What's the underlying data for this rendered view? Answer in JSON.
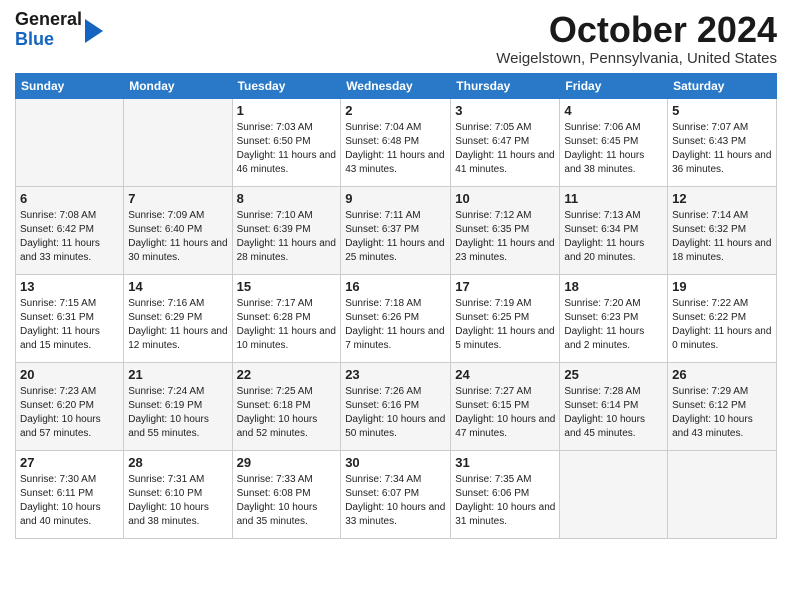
{
  "header": {
    "logo_general": "General",
    "logo_blue": "Blue",
    "month_title": "October 2024",
    "location": "Weigelstown, Pennsylvania, United States"
  },
  "days_of_week": [
    "Sunday",
    "Monday",
    "Tuesday",
    "Wednesday",
    "Thursday",
    "Friday",
    "Saturday"
  ],
  "weeks": [
    [
      {
        "day": "",
        "sunrise": "",
        "sunset": "",
        "daylight": ""
      },
      {
        "day": "",
        "sunrise": "",
        "sunset": "",
        "daylight": ""
      },
      {
        "day": "1",
        "sunrise": "Sunrise: 7:03 AM",
        "sunset": "Sunset: 6:50 PM",
        "daylight": "Daylight: 11 hours and 46 minutes."
      },
      {
        "day": "2",
        "sunrise": "Sunrise: 7:04 AM",
        "sunset": "Sunset: 6:48 PM",
        "daylight": "Daylight: 11 hours and 43 minutes."
      },
      {
        "day": "3",
        "sunrise": "Sunrise: 7:05 AM",
        "sunset": "Sunset: 6:47 PM",
        "daylight": "Daylight: 11 hours and 41 minutes."
      },
      {
        "day": "4",
        "sunrise": "Sunrise: 7:06 AM",
        "sunset": "Sunset: 6:45 PM",
        "daylight": "Daylight: 11 hours and 38 minutes."
      },
      {
        "day": "5",
        "sunrise": "Sunrise: 7:07 AM",
        "sunset": "Sunset: 6:43 PM",
        "daylight": "Daylight: 11 hours and 36 minutes."
      }
    ],
    [
      {
        "day": "6",
        "sunrise": "Sunrise: 7:08 AM",
        "sunset": "Sunset: 6:42 PM",
        "daylight": "Daylight: 11 hours and 33 minutes."
      },
      {
        "day": "7",
        "sunrise": "Sunrise: 7:09 AM",
        "sunset": "Sunset: 6:40 PM",
        "daylight": "Daylight: 11 hours and 30 minutes."
      },
      {
        "day": "8",
        "sunrise": "Sunrise: 7:10 AM",
        "sunset": "Sunset: 6:39 PM",
        "daylight": "Daylight: 11 hours and 28 minutes."
      },
      {
        "day": "9",
        "sunrise": "Sunrise: 7:11 AM",
        "sunset": "Sunset: 6:37 PM",
        "daylight": "Daylight: 11 hours and 25 minutes."
      },
      {
        "day": "10",
        "sunrise": "Sunrise: 7:12 AM",
        "sunset": "Sunset: 6:35 PM",
        "daylight": "Daylight: 11 hours and 23 minutes."
      },
      {
        "day": "11",
        "sunrise": "Sunrise: 7:13 AM",
        "sunset": "Sunset: 6:34 PM",
        "daylight": "Daylight: 11 hours and 20 minutes."
      },
      {
        "day": "12",
        "sunrise": "Sunrise: 7:14 AM",
        "sunset": "Sunset: 6:32 PM",
        "daylight": "Daylight: 11 hours and 18 minutes."
      }
    ],
    [
      {
        "day": "13",
        "sunrise": "Sunrise: 7:15 AM",
        "sunset": "Sunset: 6:31 PM",
        "daylight": "Daylight: 11 hours and 15 minutes."
      },
      {
        "day": "14",
        "sunrise": "Sunrise: 7:16 AM",
        "sunset": "Sunset: 6:29 PM",
        "daylight": "Daylight: 11 hours and 12 minutes."
      },
      {
        "day": "15",
        "sunrise": "Sunrise: 7:17 AM",
        "sunset": "Sunset: 6:28 PM",
        "daylight": "Daylight: 11 hours and 10 minutes."
      },
      {
        "day": "16",
        "sunrise": "Sunrise: 7:18 AM",
        "sunset": "Sunset: 6:26 PM",
        "daylight": "Daylight: 11 hours and 7 minutes."
      },
      {
        "day": "17",
        "sunrise": "Sunrise: 7:19 AM",
        "sunset": "Sunset: 6:25 PM",
        "daylight": "Daylight: 11 hours and 5 minutes."
      },
      {
        "day": "18",
        "sunrise": "Sunrise: 7:20 AM",
        "sunset": "Sunset: 6:23 PM",
        "daylight": "Daylight: 11 hours and 2 minutes."
      },
      {
        "day": "19",
        "sunrise": "Sunrise: 7:22 AM",
        "sunset": "Sunset: 6:22 PM",
        "daylight": "Daylight: 11 hours and 0 minutes."
      }
    ],
    [
      {
        "day": "20",
        "sunrise": "Sunrise: 7:23 AM",
        "sunset": "Sunset: 6:20 PM",
        "daylight": "Daylight: 10 hours and 57 minutes."
      },
      {
        "day": "21",
        "sunrise": "Sunrise: 7:24 AM",
        "sunset": "Sunset: 6:19 PM",
        "daylight": "Daylight: 10 hours and 55 minutes."
      },
      {
        "day": "22",
        "sunrise": "Sunrise: 7:25 AM",
        "sunset": "Sunset: 6:18 PM",
        "daylight": "Daylight: 10 hours and 52 minutes."
      },
      {
        "day": "23",
        "sunrise": "Sunrise: 7:26 AM",
        "sunset": "Sunset: 6:16 PM",
        "daylight": "Daylight: 10 hours and 50 minutes."
      },
      {
        "day": "24",
        "sunrise": "Sunrise: 7:27 AM",
        "sunset": "Sunset: 6:15 PM",
        "daylight": "Daylight: 10 hours and 47 minutes."
      },
      {
        "day": "25",
        "sunrise": "Sunrise: 7:28 AM",
        "sunset": "Sunset: 6:14 PM",
        "daylight": "Daylight: 10 hours and 45 minutes."
      },
      {
        "day": "26",
        "sunrise": "Sunrise: 7:29 AM",
        "sunset": "Sunset: 6:12 PM",
        "daylight": "Daylight: 10 hours and 43 minutes."
      }
    ],
    [
      {
        "day": "27",
        "sunrise": "Sunrise: 7:30 AM",
        "sunset": "Sunset: 6:11 PM",
        "daylight": "Daylight: 10 hours and 40 minutes."
      },
      {
        "day": "28",
        "sunrise": "Sunrise: 7:31 AM",
        "sunset": "Sunset: 6:10 PM",
        "daylight": "Daylight: 10 hours and 38 minutes."
      },
      {
        "day": "29",
        "sunrise": "Sunrise: 7:33 AM",
        "sunset": "Sunset: 6:08 PM",
        "daylight": "Daylight: 10 hours and 35 minutes."
      },
      {
        "day": "30",
        "sunrise": "Sunrise: 7:34 AM",
        "sunset": "Sunset: 6:07 PM",
        "daylight": "Daylight: 10 hours and 33 minutes."
      },
      {
        "day": "31",
        "sunrise": "Sunrise: 7:35 AM",
        "sunset": "Sunset: 6:06 PM",
        "daylight": "Daylight: 10 hours and 31 minutes."
      },
      {
        "day": "",
        "sunrise": "",
        "sunset": "",
        "daylight": ""
      },
      {
        "day": "",
        "sunrise": "",
        "sunset": "",
        "daylight": ""
      }
    ]
  ]
}
